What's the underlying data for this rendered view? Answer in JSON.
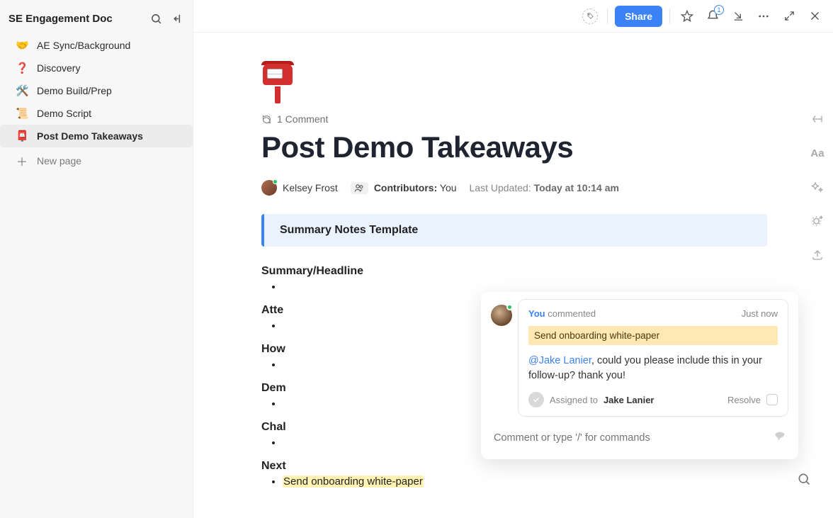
{
  "sidebar": {
    "title": "SE Engagement Doc",
    "items": [
      {
        "emoji": "🤝",
        "label": "AE Sync/Background"
      },
      {
        "emoji": "❓",
        "label": "Discovery",
        "emoji_color": "#d33"
      },
      {
        "emoji": "🛠️",
        "label": "Demo Build/Prep"
      },
      {
        "emoji": "📜",
        "label": "Demo Script"
      },
      {
        "emoji": "📮",
        "label": "Post Demo Takeaways",
        "active": true
      }
    ],
    "new_page_label": "New page"
  },
  "topbar": {
    "share_label": "Share",
    "notification_count": "1"
  },
  "doc": {
    "comment_count": "1 Comment",
    "title": "Post Demo Takeaways",
    "author": "Kelsey Frost",
    "contributors_label": "Contributors:",
    "contributors_value": "You",
    "updated_label": "Last Updated:",
    "updated_value": "Today at 10:14 am",
    "callout": "Summary Notes Template",
    "sections": {
      "s1": "Summary/Headline",
      "s2": "Atte",
      "s3": "How",
      "s4": "Dem",
      "s5": "Chal",
      "s6": "Next"
    },
    "next_step_item": "Send onboarding white-paper"
  },
  "comment_popup": {
    "you_label": "You",
    "action": "commented",
    "time": "Just now",
    "quoted_text": "Send onboarding white-paper",
    "mention": "@Jake Lanier",
    "message_rest": ", could you please include this in your follow-up? thank you!",
    "assigned_label": "Assigned to",
    "assignee": "Jake Lanier",
    "resolve_label": "Resolve",
    "input_placeholder": "Comment or type '/' for commands"
  },
  "rightrail": {
    "aa": "Aa"
  }
}
